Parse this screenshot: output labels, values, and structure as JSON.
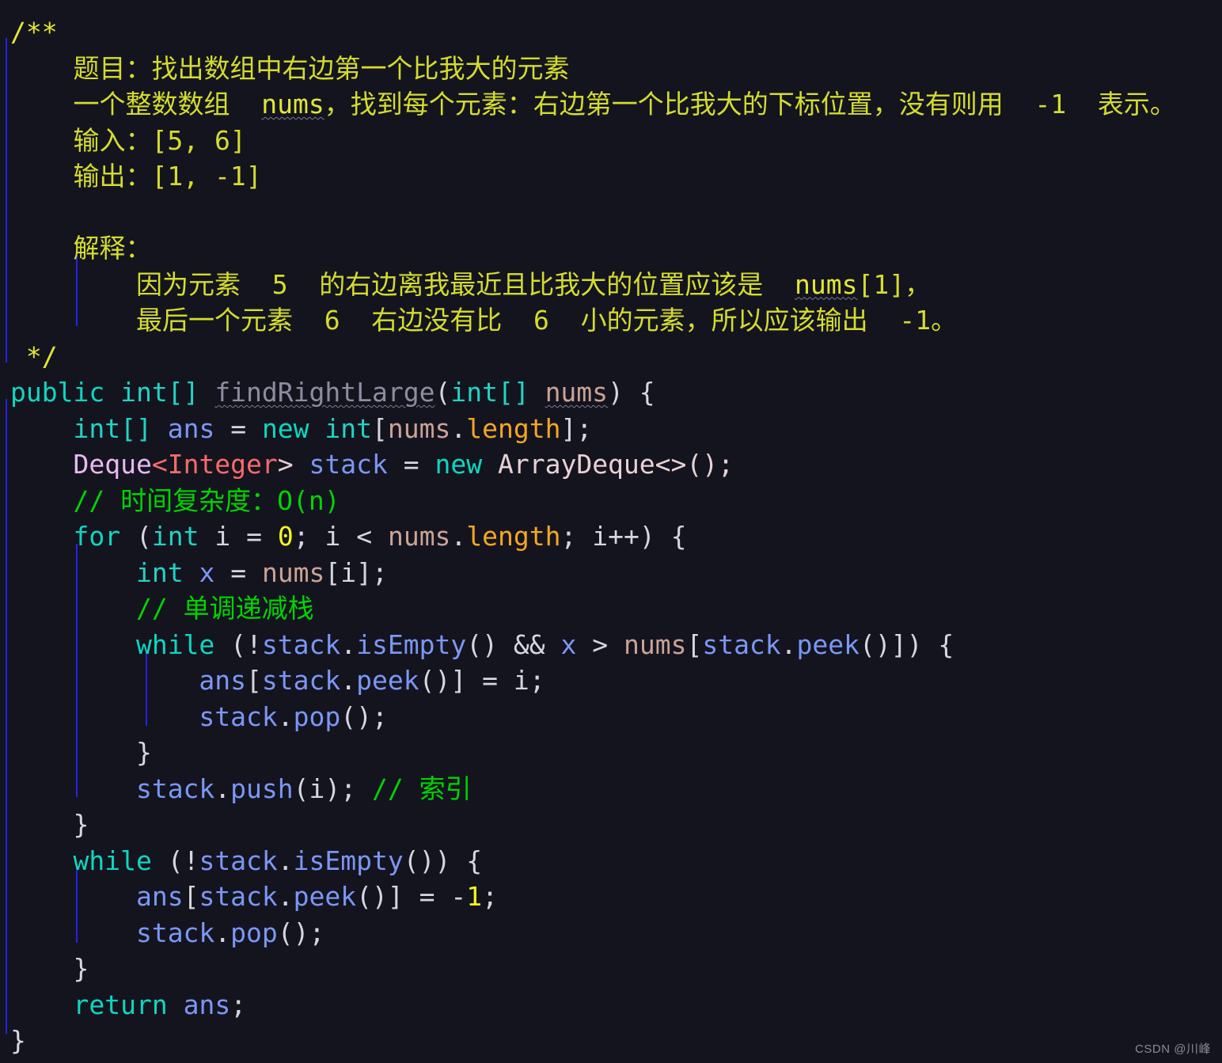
{
  "editor": {
    "language": "java",
    "background_color": "#14141f",
    "indent_guide_color": "#2323e8",
    "watermark": "CSDN @川峰"
  },
  "colors": {
    "block_comment": "#e2e634",
    "line_comment": "#00d400",
    "keyword": "#0fd6c0",
    "class_name": "#e8b9f0",
    "generic_type": "#f86a6a",
    "local_variable": "#7b97f5",
    "parameter": "#c9a396",
    "field": "#f5a623",
    "number": "#f5f524",
    "plain_text": "#d6d6e0",
    "method_declaration": "#8d8da0"
  },
  "code": {
    "doc_comment": {
      "open": "/**",
      "close": " */",
      "title_label": "题目：找出数组中右边第一个比我大的元素",
      "description": "一个整数数组  nums，找到每个元素：右边第一个比我大的下标位置，没有则用  -1  表示。",
      "description_pre": "一个整数数组  ",
      "description_sym": "nums",
      "description_post": "，找到每个元素：右边第一个比我大的下标位置，没有则用  -1  表示。",
      "input_line": "输入：[5, 6]",
      "output_line": "输出：[1, -1]",
      "explain_label": "解释：",
      "explain_line1_pre": "因为元素  5  的右边离我最近且比我大的位置应该是  ",
      "explain_line1_sym": "nums",
      "explain_line1_post": "[1]，",
      "explain_line2": "最后一个元素  6  右边没有比  6  小的元素，所以应该输出  -1。"
    },
    "signature": {
      "modifier": "public",
      "return_type": "int[]",
      "method_name": "findRightLarge",
      "param_type": "int[]",
      "param_name": "nums",
      "open_brace": "{"
    },
    "body": {
      "decl_ans_type": "int[]",
      "decl_ans_name": "ans",
      "decl_ans_eq": "=",
      "decl_ans_new": "new",
      "decl_ans_init_type": "int",
      "decl_ans_obj": "nums",
      "decl_ans_field": "length",
      "decl_stack_class": "Deque",
      "decl_stack_generic": "Integer",
      "decl_stack_name": "stack",
      "decl_stack_new": "new",
      "decl_stack_impl": "ArrayDeque",
      "comment_complexity": "// 时间复杂度：O(n)",
      "comment_complexity_slashes": "//",
      "comment_complexity_text": " 时间复杂度：O(n)",
      "for_keyword": "for",
      "for_init_type": "int",
      "for_var": "i",
      "for_init_value": "0",
      "for_limit_obj": "nums",
      "for_limit_field": "length",
      "for_increment": "i++",
      "stmt_x_type": "int",
      "stmt_x_name": "x",
      "stmt_x_obj": "nums",
      "stmt_x_index": "i",
      "comment_monotonic_slashes": "//",
      "comment_monotonic_text": " 单调递减栈",
      "while_keyword": "while",
      "while_cond_obj": "stack",
      "while_cond_method": "isEmpty",
      "while_cond_and": "&&",
      "while_cond_var": "x",
      "while_cond_gt": ">",
      "while_cond_arr": "nums",
      "while_cond_peek_obj": "stack",
      "while_cond_peek": "peek",
      "assign_ans": "ans",
      "assign_peek_obj": "stack",
      "assign_peek": "peek",
      "assign_value": "i",
      "pop_obj": "stack",
      "pop_method": "pop",
      "push_obj": "stack",
      "push_method": "push",
      "push_arg": "i",
      "comment_index_slashes": "//",
      "comment_index_text": " 索引",
      "while2_keyword": "while",
      "while2_obj": "stack",
      "while2_method": "isEmpty",
      "assign2_ans": "ans",
      "assign2_peek_obj": "stack",
      "assign2_peek": "peek",
      "assign2_value": "1",
      "assign2_minus": "-",
      "pop2_obj": "stack",
      "pop2_method": "pop",
      "return_keyword": "return",
      "return_value": "ans",
      "close_brace": "}"
    }
  }
}
